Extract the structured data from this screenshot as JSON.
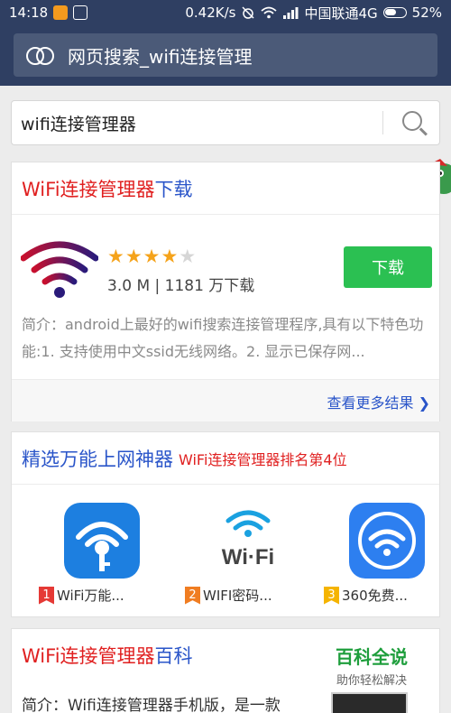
{
  "status_bar": {
    "time": "14:18",
    "network_speed": "0.42K/s",
    "carrier": "中国联通4G",
    "battery": "52%"
  },
  "browser": {
    "page_title": "网页搜索_wifi连接管理"
  },
  "search": {
    "query": "wifi连接管理器"
  },
  "download_card": {
    "title_red": "WiFi连接管理器",
    "title_blue": "下载",
    "rating": 4,
    "rating_max": 5,
    "size_and_downloads": "3.0 M | 1181 万下载",
    "download_button": "下载",
    "description": "简介：android上最好的wifi搜索连接管理程序,具有以下特色功能:1. 支持使用中文ssid无线网络。2. 显示已保存网...",
    "more_results": "查看更多结果 ❯"
  },
  "featured_card": {
    "title_blue": "精选万能上网神器",
    "title_red": "WiFi连接管理器排名第4位",
    "apps": [
      {
        "rank": "1",
        "label": "WiFi万能...",
        "icon": "wifi-key-icon",
        "rank_color": "#e53935"
      },
      {
        "rank": "2",
        "label": "WIFI密码...",
        "icon": "wifi-text-icon",
        "rank_color": "#f07d22"
      },
      {
        "rank": "3",
        "label": "360免费...",
        "icon": "wifi-360-icon",
        "rank_color": "#f5b400"
      }
    ]
  },
  "baike_card": {
    "title_red": "WiFi连接管理器",
    "title_blue": "百科",
    "snippet": "简介：Wifi连接管理器手机版，是一款"
  },
  "watermark": {
    "title": "百科全说",
    "subtitle": "助你轻松解决"
  },
  "colors": {
    "header_bg": "#2f3f62",
    "accent_red": "#e02020",
    "accent_blue": "#2a55c9",
    "download_green": "#2bc052"
  }
}
